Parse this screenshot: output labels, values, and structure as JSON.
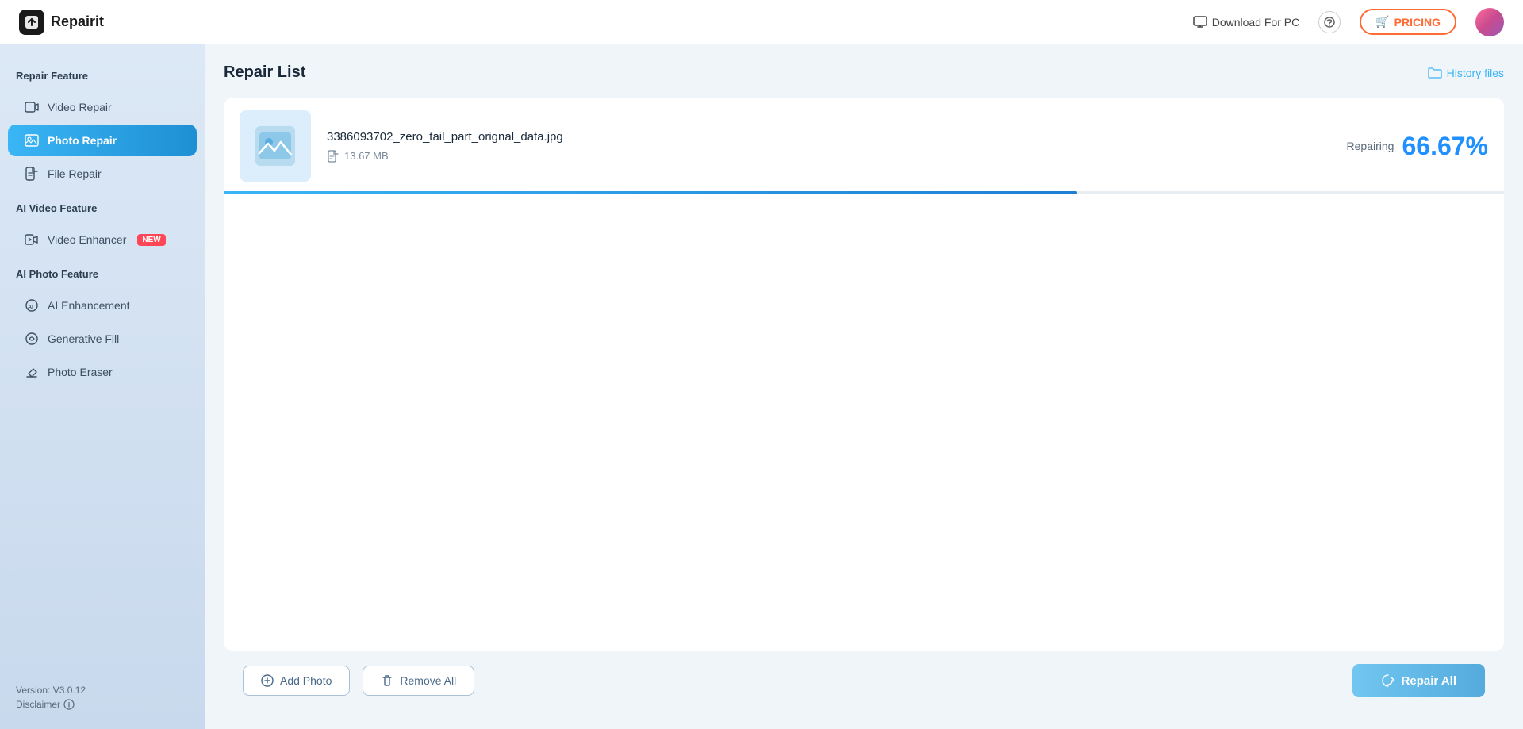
{
  "header": {
    "logo_text": "Repairit",
    "download_pc_label": "Download For PC",
    "pricing_label": "PRICING",
    "pricing_icon": "🛒"
  },
  "sidebar": {
    "repair_feature_label": "Repair Feature",
    "ai_video_feature_label": "AI Video Feature",
    "ai_photo_feature_label": "AI Photo Feature",
    "items": [
      {
        "id": "video-repair",
        "label": "Video Repair",
        "active": false
      },
      {
        "id": "photo-repair",
        "label": "Photo Repair",
        "active": true
      },
      {
        "id": "file-repair",
        "label": "File Repair",
        "active": false
      },
      {
        "id": "video-enhancer",
        "label": "Video Enhancer",
        "active": false,
        "badge": "NEW"
      },
      {
        "id": "ai-enhancement",
        "label": "AI Enhancement",
        "active": false
      },
      {
        "id": "generative-fill",
        "label": "Generative Fill",
        "active": false
      },
      {
        "id": "photo-eraser",
        "label": "Photo Eraser",
        "active": false
      }
    ],
    "version": "Version: V3.0.12",
    "disclaimer": "Disclaimer"
  },
  "content": {
    "title": "Repair List",
    "history_files_label": "History files"
  },
  "repair_items": [
    {
      "name": "3386093702_zero_tail_part_orignal_data.jpg",
      "size": "13.67 MB",
      "status": "Repairing",
      "progress": "66.67%",
      "progress_value": 66.67
    }
  ],
  "bottom": {
    "add_photo_label": "Add Photo",
    "remove_all_label": "Remove All",
    "repair_all_label": "Repair All"
  }
}
